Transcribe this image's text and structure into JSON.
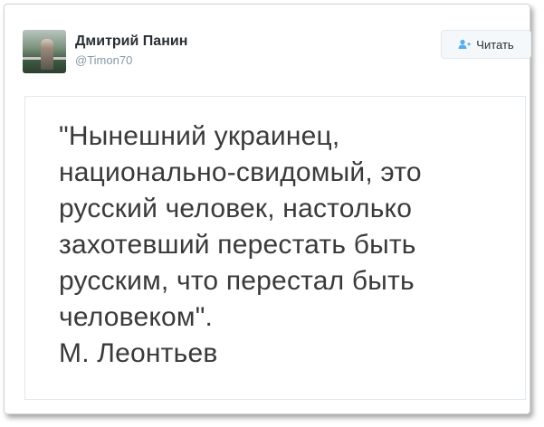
{
  "user": {
    "name": "Дмитрий Панин",
    "handle": "@Timon70"
  },
  "follow_button": {
    "label": "Читать",
    "icon": "follow-person-plus-icon"
  },
  "quote": {
    "text": "\"Нынешний украинец,\nнационально-свидомый, это\nрусский человек, настолько\nзахотевший перестать быть\nрусским, что перестал быть\nчеловеком\".\nМ. Леонтьев"
  },
  "colors": {
    "name": "#292f33",
    "handle": "#8899a6",
    "border": "#e1e8ed",
    "quote_text": "#3a3a3a"
  }
}
